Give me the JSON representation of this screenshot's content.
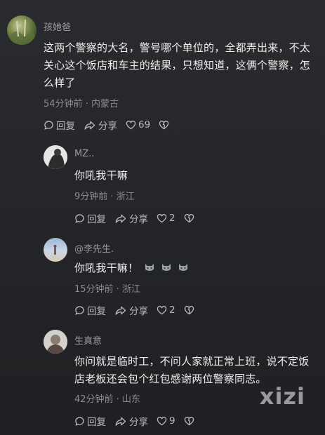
{
  "comments": [
    {
      "username": "孩她爸",
      "text": "这两个警察的大名，警号哪个单位的，全都弄出来，不太关心这个饭店和车主的结果，只想知道，这俩个警察，怎么样了",
      "time_location": "54分钟前 · 内蒙古",
      "reply_label": "回复",
      "share_label": "分享",
      "likes": "69"
    },
    {
      "username": "MZ..",
      "text": "你吼我干嘛",
      "time_location": "9分钟前 · 浙江",
      "reply_label": "回复",
      "share_label": "分享",
      "likes": "2"
    },
    {
      "username": "@李先生.",
      "text": "你吼我干嘛！",
      "emojis": [
        "cat-emoji",
        "cat-emoji",
        "cat-emoji"
      ],
      "time_location": "15分钟前 · 浙江",
      "reply_label": "回复",
      "share_label": "分享",
      "likes": "2"
    },
    {
      "username": "生真意",
      "text": "你问就是临时工，不问人家就正常上班，说不定饭店老板还会包个红包感谢两位警察同志。",
      "time_location": "42分钟前 · 山东",
      "reply_label": "回复",
      "share_label": "分享",
      "likes": "9"
    }
  ],
  "watermark": "xizi",
  "colors": {
    "background": "#232427",
    "text": "#eeeeef",
    "meta": "#8b8c91",
    "name": "#9a9ba0"
  }
}
